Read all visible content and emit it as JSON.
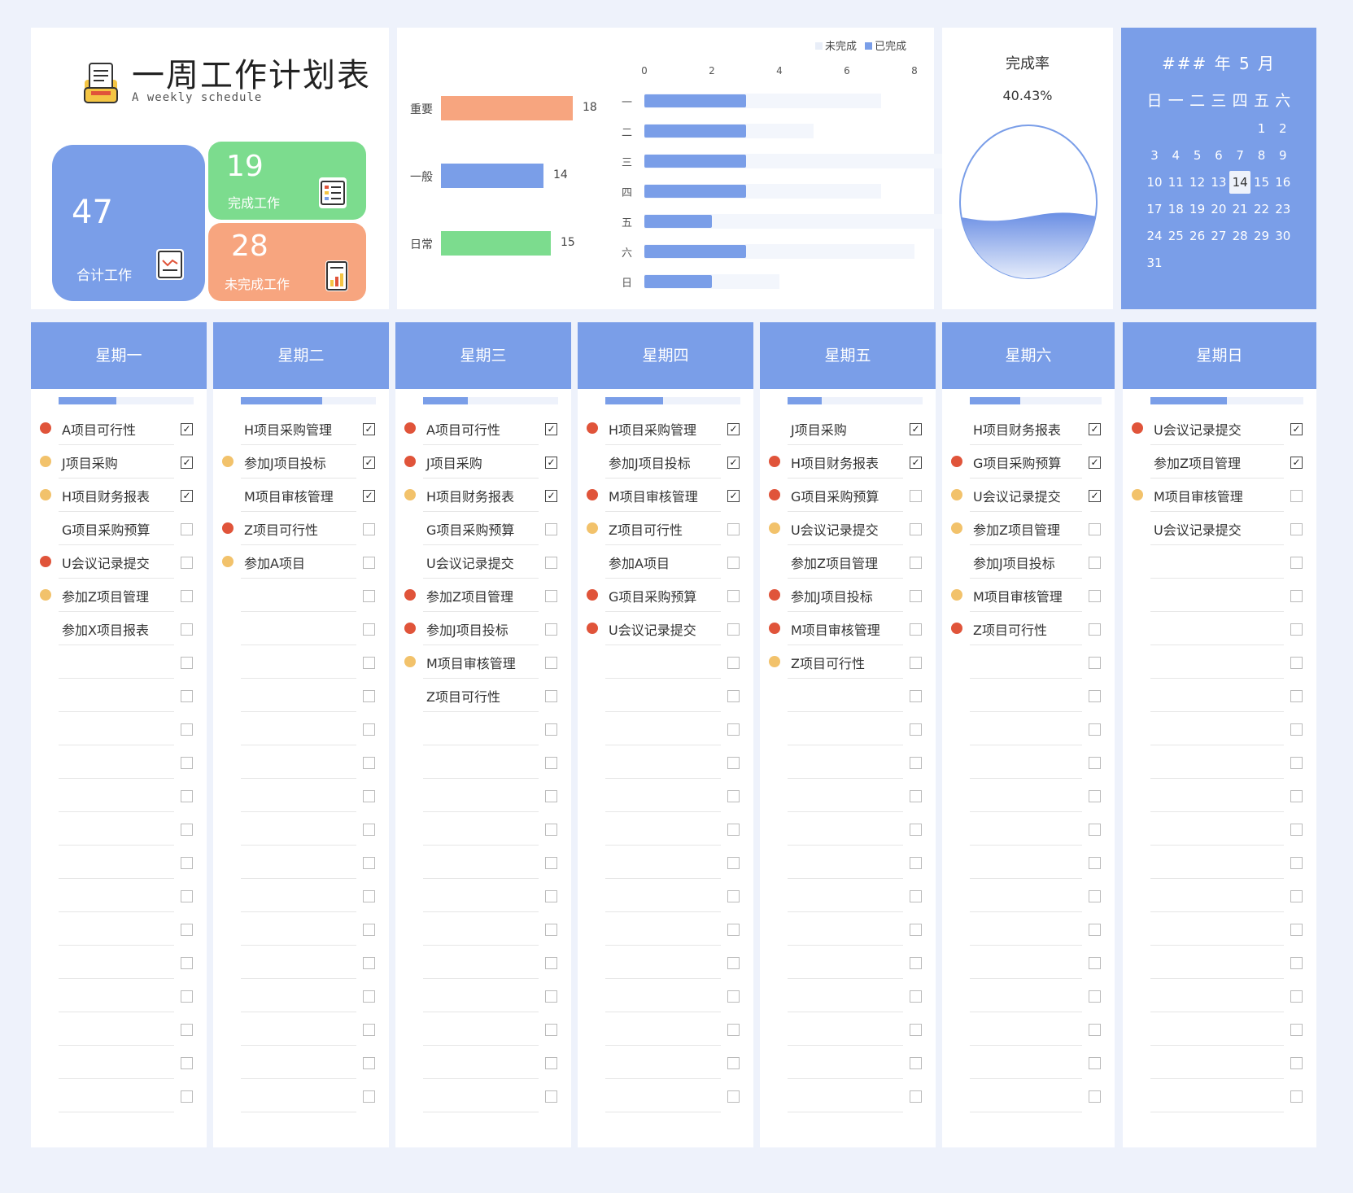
{
  "header": {
    "title": "一周工作计划表",
    "subtitle": "A weekly schedule"
  },
  "cards": {
    "total": {
      "value": "47",
      "label": "合计工作"
    },
    "done": {
      "value": "19",
      "label": "完成工作"
    },
    "undone": {
      "value": "28",
      "label": "未完成工作"
    }
  },
  "colors": {
    "accent": "#7a9ee8",
    "done": "#7cdc8e",
    "undone": "#f7a57f",
    "dot_red": "#e0543a",
    "dot_yellow": "#f2c26b"
  },
  "chart_data": [
    {
      "type": "bar",
      "orientation": "horizontal",
      "categories": [
        "重要",
        "一般",
        "日常"
      ],
      "values": [
        18,
        14,
        15
      ],
      "colors": [
        "#f7a57f",
        "#7a9ee8",
        "#7cdc8e"
      ]
    },
    {
      "type": "bar",
      "orientation": "horizontal",
      "stacked": true,
      "categories": [
        "一",
        "二",
        "三",
        "四",
        "五",
        "六",
        "日"
      ],
      "x_ticks": [
        "0",
        "2",
        "4",
        "6",
        "8"
      ],
      "xlim": [
        0,
        8
      ],
      "legend_position": "top-right",
      "series": [
        {
          "name": "未完成",
          "color": "#f3f6fc",
          "values": [
            4,
            2,
            6,
            4,
            8,
            5,
            2
          ]
        },
        {
          "name": "已完成",
          "color": "#7a9ee8",
          "values": [
            3,
            3,
            3,
            3,
            2,
            3,
            2
          ]
        }
      ]
    }
  ],
  "rate": {
    "title": "完成率",
    "value": "40.43%",
    "fraction": 0.4043
  },
  "calendar": {
    "header": "### 年  5  月",
    "weekdays": [
      "日",
      "一",
      "二",
      "三",
      "四",
      "五",
      "六"
    ],
    "first_weekday": 5,
    "days_in_month": 31,
    "today": 14
  },
  "days": [
    {
      "name": "星期一",
      "progress": 0.43,
      "tasks": [
        {
          "label": "A项目可行性",
          "dot": "red",
          "done": true
        },
        {
          "label": "J项目采购",
          "dot": "yellow",
          "done": true
        },
        {
          "label": "H项目财务报表",
          "dot": "yellow",
          "done": true
        },
        {
          "label": "G项目采购预算",
          "dot": "",
          "done": false
        },
        {
          "label": "U会议记录提交",
          "dot": "red",
          "done": false
        },
        {
          "label": "参加Z项目管理",
          "dot": "yellow",
          "done": false
        },
        {
          "label": "参加X项目报表",
          "dot": "",
          "done": false
        }
      ]
    },
    {
      "name": "星期二",
      "progress": 0.6,
      "tasks": [
        {
          "label": "H项目采购管理",
          "dot": "",
          "done": true
        },
        {
          "label": "参加J项目投标",
          "dot": "yellow",
          "done": true
        },
        {
          "label": "M项目审核管理",
          "dot": "",
          "done": true
        },
        {
          "label": "Z项目可行性",
          "dot": "red",
          "done": false
        },
        {
          "label": "参加A项目",
          "dot": "yellow",
          "done": false
        }
      ]
    },
    {
      "name": "星期三",
      "progress": 0.33,
      "tasks": [
        {
          "label": "A项目可行性",
          "dot": "red",
          "done": true
        },
        {
          "label": "J项目采购",
          "dot": "red",
          "done": true
        },
        {
          "label": "H项目财务报表",
          "dot": "yellow",
          "done": true
        },
        {
          "label": "G项目采购预算",
          "dot": "",
          "done": false
        },
        {
          "label": "U会议记录提交",
          "dot": "",
          "done": false
        },
        {
          "label": "参加Z项目管理",
          "dot": "red",
          "done": false
        },
        {
          "label": "参加J项目投标",
          "dot": "red",
          "done": false
        },
        {
          "label": "M项目审核管理",
          "dot": "yellow",
          "done": false
        },
        {
          "label": "Z项目可行性",
          "dot": "",
          "done": false
        }
      ]
    },
    {
      "name": "星期四",
      "progress": 0.43,
      "tasks": [
        {
          "label": "H项目采购管理",
          "dot": "red",
          "done": true
        },
        {
          "label": "参加J项目投标",
          "dot": "",
          "done": true
        },
        {
          "label": "M项目审核管理",
          "dot": "red",
          "done": true
        },
        {
          "label": "Z项目可行性",
          "dot": "yellow",
          "done": false
        },
        {
          "label": "参加A项目",
          "dot": "",
          "done": false
        },
        {
          "label": "G项目采购预算",
          "dot": "red",
          "done": false
        },
        {
          "label": "U会议记录提交",
          "dot": "red",
          "done": false
        }
      ]
    },
    {
      "name": "星期五",
      "progress": 0.25,
      "tasks": [
        {
          "label": "J项目采购",
          "dot": "",
          "done": true
        },
        {
          "label": "H项目财务报表",
          "dot": "red",
          "done": true
        },
        {
          "label": "G项目采购预算",
          "dot": "red",
          "done": false
        },
        {
          "label": "U会议记录提交",
          "dot": "yellow",
          "done": false
        },
        {
          "label": "参加Z项目管理",
          "dot": "",
          "done": false
        },
        {
          "label": "参加J项目投标",
          "dot": "red",
          "done": false
        },
        {
          "label": "M项目审核管理",
          "dot": "red",
          "done": false
        },
        {
          "label": "Z项目可行性",
          "dot": "yellow",
          "done": false
        }
      ]
    },
    {
      "name": "星期六",
      "progress": 0.38,
      "tasks": [
        {
          "label": "H项目财务报表",
          "dot": "",
          "done": true
        },
        {
          "label": "G项目采购预算",
          "dot": "red",
          "done": true
        },
        {
          "label": "U会议记录提交",
          "dot": "yellow",
          "done": true
        },
        {
          "label": "参加Z项目管理",
          "dot": "yellow",
          "done": false
        },
        {
          "label": "参加J项目投标",
          "dot": "",
          "done": false
        },
        {
          "label": "M项目审核管理",
          "dot": "yellow",
          "done": false
        },
        {
          "label": "Z项目可行性",
          "dot": "red",
          "done": false
        }
      ]
    },
    {
      "name": "星期日",
      "progress": 0.5,
      "tasks": [
        {
          "label": "U会议记录提交",
          "dot": "red",
          "done": true
        },
        {
          "label": "参加Z项目管理",
          "dot": "",
          "done": true
        },
        {
          "label": "M项目审核管理",
          "dot": "yellow",
          "done": false
        },
        {
          "label": "U会议记录提交",
          "dot": "",
          "done": false
        }
      ]
    }
  ]
}
